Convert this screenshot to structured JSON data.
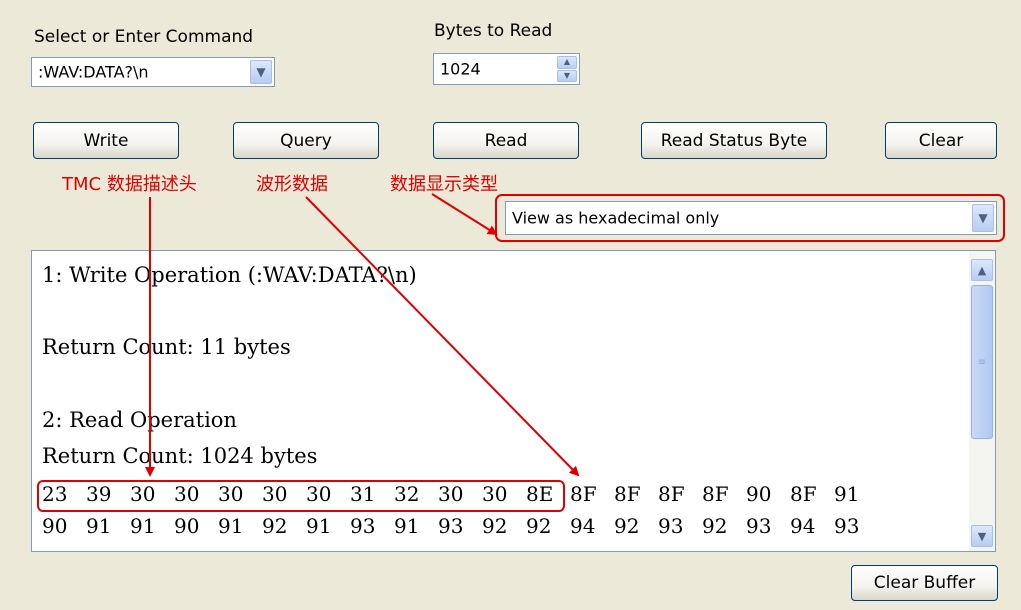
{
  "command": {
    "label": "Select or Enter Command",
    "value": ":WAV:DATA?\\n"
  },
  "bytes": {
    "label": "Bytes to Read",
    "value": "1024"
  },
  "buttons": {
    "write": "Write",
    "query": "Query",
    "read": "Read",
    "read_status": "Read Status Byte",
    "clear": "Clear",
    "clear_buffer": "Clear Buffer"
  },
  "display_type": {
    "value": "View as hexadecimal only"
  },
  "annotations": {
    "tmc_header": "TMC 数据描述头",
    "waveform": "波形数据",
    "display_type": "数据显示类型"
  },
  "output": {
    "line1": "1: Write Operation (:WAV:DATA?\\n)",
    "line2": "Return Count: 11 bytes",
    "line3": "2: Read Operation",
    "line4": "Return Count: 1024 bytes",
    "hex_row1": [
      "23",
      "39",
      "30",
      "30",
      "30",
      "30",
      "30",
      "31",
      "32",
      "30",
      "30",
      "8E",
      "8F",
      "8F",
      "8F",
      "8F",
      "90",
      "8F",
      "91"
    ],
    "hex_row2": [
      "90",
      "91",
      "91",
      "90",
      "91",
      "92",
      "91",
      "93",
      "91",
      "93",
      "92",
      "92",
      "94",
      "92",
      "93",
      "92",
      "93",
      "94",
      "93"
    ]
  },
  "colors": {
    "annotation": "#e00000",
    "window_bg": "#ece9d8",
    "border": "#7f9db9"
  },
  "icons": {
    "dropdown": "chevron-down-icon",
    "spinner": "spinner-arrows-icon",
    "scroll_up": "scroll-up-icon",
    "scroll_down": "scroll-down-icon"
  }
}
